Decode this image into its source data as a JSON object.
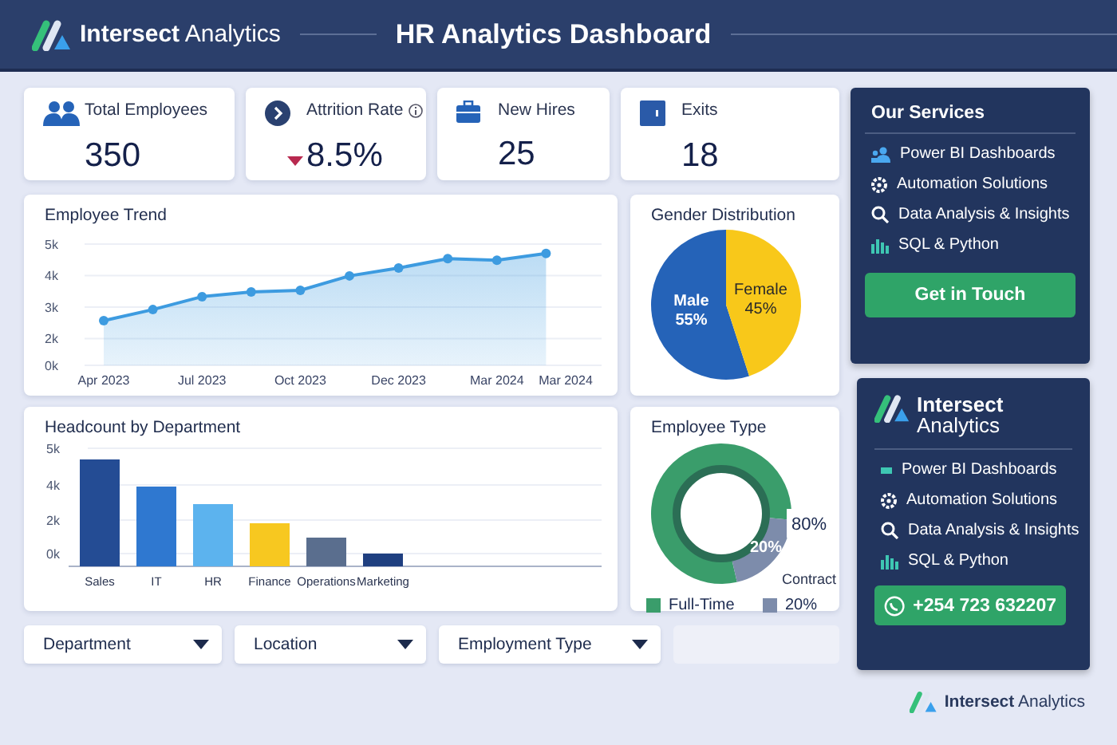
{
  "header": {
    "logo": {
      "bold": "Intersect",
      "light": "Analytics"
    },
    "title": "HR Analytics Dashboard"
  },
  "kpis": [
    {
      "kind": "people",
      "label": "Total Employees",
      "value": "350"
    },
    {
      "kind": "chevron",
      "label": "Attrition Rate",
      "info": true,
      "down": true,
      "value": "8.5%"
    },
    {
      "kind": "briefcase",
      "label": "New Hires",
      "value": "25"
    },
    {
      "kind": "door",
      "label": "Exits",
      "value": "18"
    }
  ],
  "trend_card": {
    "title": "Employee Trend",
    "chart_data": {
      "type": "area",
      "categories": [
        "Apr 2023",
        null,
        "Jul 2023",
        null,
        "Oct 2023",
        null,
        "Dec 2023",
        null,
        "Mar 2024",
        null
      ],
      "grid": true,
      "series": [
        {
          "color": "#3d9be0",
          "values": [
            2570,
            2920,
            3330,
            3480,
            3530,
            3990,
            4240,
            4540,
            4490,
            4700
          ]
        }
      ],
      "yticks": [
        {
          "value": 5000,
          "label": "5k"
        },
        {
          "value": 4000,
          "label": "4k"
        },
        {
          "value": 3000,
          "label": "3k"
        },
        {
          "value": 2000,
          "label": "2k"
        }
      ],
      "ylim": [
        1150,
        5000
      ]
    },
    "baseline_label": "0k",
    "end_label": "Mar 2024"
  },
  "gender_card": {
    "title": "Gender Distribution",
    "chart_data": {
      "type": "pie",
      "categories": [
        "Male",
        "Female"
      ],
      "values": [
        55,
        45
      ],
      "value_labels": [
        "55%",
        "45%"
      ],
      "colors": [
        "#2563b8",
        "#f8c81a"
      ]
    }
  },
  "headcount_card": {
    "title": "Headcount by Department",
    "y_labels": [
      "5k",
      "4k",
      "2k",
      "0k"
    ],
    "departments": [
      {
        "label": "Sales",
        "color": "#244c94"
      },
      {
        "label": "IT",
        "color": "#2f78d0"
      },
      {
        "label": "HR",
        "color": "#5cb3ee"
      },
      {
        "label": "Finance",
        "color": "#f7c820"
      },
      {
        "label": "Operations",
        "color": "#5a6e8e"
      },
      {
        "label": "Marketing",
        "color": "#1f3f80"
      }
    ]
  },
  "type_card": {
    "title": "Employee Type",
    "chart_data": {
      "type": "donut",
      "categories": [
        "Full-Time",
        "Contract"
      ],
      "values": [
        80,
        20
      ],
      "colors": [
        "#3a9d6b",
        "#7d8cab"
      ],
      "value_labels": [
        "80%",
        "20%"
      ],
      "annotations": [
        {
          "text": "20%"
        }
      ]
    }
  },
  "filters": [
    {
      "kind": "dropdown",
      "label": "Department"
    },
    {
      "kind": "dropdown",
      "label": "Location"
    },
    {
      "kind": "dropdown",
      "label": "Employment Type"
    },
    {
      "kind": "empty"
    }
  ],
  "services_card": {
    "title": "Our Services",
    "items": [
      {
        "kind": "people",
        "label": "Power BI Dashboards"
      },
      {
        "kind": "gear",
        "label": "Automation Solutions"
      },
      {
        "kind": "search",
        "label": "Data Analysis & Insights"
      },
      {
        "kind": "bars",
        "label": "SQL & Python"
      }
    ],
    "button": "Get in Touch"
  },
  "contact_card": {
    "logo": {
      "line1": "Intersect",
      "line2": "Analytics"
    },
    "items": [
      {
        "kind": "dash",
        "label": "Power BI Dashboards"
      },
      {
        "kind": "gear",
        "label": "Automation Solutions"
      },
      {
        "kind": "search",
        "label": "Data Analysis & Insights"
      },
      {
        "kind": "bars",
        "label": "SQL & Python"
      }
    ],
    "phone_button": "+254 723 632207"
  },
  "footer": {
    "logo": {
      "bold": "Intersect",
      "light": "Analytics"
    }
  }
}
